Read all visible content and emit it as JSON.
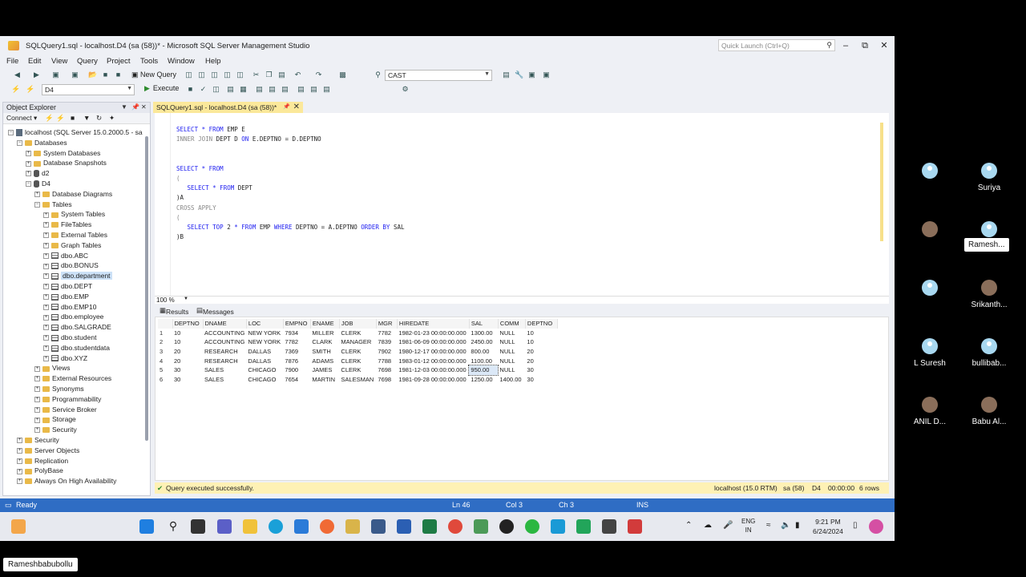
{
  "window": {
    "title": "SQLQuery1.sql - localhost.D4 (sa (58))* - Microsoft SQL Server Management Studio",
    "quick_launch_placeholder": "Quick Launch (Ctrl+Q)"
  },
  "menu": [
    "File",
    "Edit",
    "View",
    "Query",
    "Project",
    "Tools",
    "Window",
    "Help"
  ],
  "toolbar": {
    "new_query_label": "New Query",
    "find_combo_value": "CAST",
    "database_combo_value": "D4",
    "execute_label": "Execute"
  },
  "object_explorer": {
    "title": "Object Explorer",
    "connect_label": "Connect ▾",
    "nodes": [
      {
        "label": "localhost (SQL Server 15.0.2000.5 - sa",
        "type": "server",
        "exp": "−"
      },
      {
        "label": "Databases",
        "type": "folder",
        "exp": "−"
      },
      {
        "label": "System Databases",
        "type": "folder",
        "exp": "+"
      },
      {
        "label": "Database Snapshots",
        "type": "folder",
        "exp": "+"
      },
      {
        "label": "d2",
        "type": "db",
        "exp": "+"
      },
      {
        "label": "D4",
        "type": "db",
        "exp": "−"
      },
      {
        "label": "Database Diagrams",
        "type": "folder",
        "exp": "+"
      },
      {
        "label": "Tables",
        "type": "folder",
        "exp": "−"
      },
      {
        "label": "System Tables",
        "type": "folder",
        "exp": "+"
      },
      {
        "label": "FileTables",
        "type": "folder",
        "exp": "+"
      },
      {
        "label": "External Tables",
        "type": "folder",
        "exp": "+"
      },
      {
        "label": "Graph Tables",
        "type": "folder",
        "exp": "+"
      },
      {
        "label": "dbo.ABC",
        "type": "table",
        "exp": "+"
      },
      {
        "label": "dbo.BONUS",
        "type": "table",
        "exp": "+"
      },
      {
        "label": "dbo.department",
        "type": "table",
        "exp": "+",
        "selected": true
      },
      {
        "label": "dbo.DEPT",
        "type": "table",
        "exp": "+"
      },
      {
        "label": "dbo.EMP",
        "type": "table",
        "exp": "+"
      },
      {
        "label": "dbo.EMP10",
        "type": "table",
        "exp": "+"
      },
      {
        "label": "dbo.employee",
        "type": "table",
        "exp": "+"
      },
      {
        "label": "dbo.SALGRADE",
        "type": "table",
        "exp": "+"
      },
      {
        "label": "dbo.student",
        "type": "table",
        "exp": "+"
      },
      {
        "label": "dbo.studentdata",
        "type": "table",
        "exp": "+"
      },
      {
        "label": "dbo.XYZ",
        "type": "table",
        "exp": "+"
      },
      {
        "label": "Views",
        "type": "folder",
        "exp": "+"
      },
      {
        "label": "External Resources",
        "type": "folder",
        "exp": "+"
      },
      {
        "label": "Synonyms",
        "type": "folder",
        "exp": "+"
      },
      {
        "label": "Programmability",
        "type": "folder",
        "exp": "+"
      },
      {
        "label": "Service Broker",
        "type": "folder",
        "exp": "+"
      },
      {
        "label": "Storage",
        "type": "folder",
        "exp": "+"
      },
      {
        "label": "Security",
        "type": "folder",
        "exp": "+"
      },
      {
        "label": "Security",
        "type": "folder",
        "exp": "+"
      },
      {
        "label": "Server Objects",
        "type": "folder",
        "exp": "+"
      },
      {
        "label": "Replication",
        "type": "folder",
        "exp": "+"
      },
      {
        "label": "PolyBase",
        "type": "folder",
        "exp": "+"
      },
      {
        "label": "Always On High Availability",
        "type": "folder",
        "exp": "+"
      }
    ]
  },
  "editor": {
    "tab_label": "SQLQuery1.sql - localhost.D4 (sa (58))*",
    "zoom": "100 %",
    "lines": [
      [
        {
          "t": "SELECT * FROM ",
          "c": "kw"
        },
        {
          "t": "EMP E",
          "c": "tx"
        }
      ],
      [
        {
          "t": "INNER JOIN ",
          "c": "gr"
        },
        {
          "t": "DEPT D ",
          "c": "tx"
        },
        {
          "t": "ON ",
          "c": "kw"
        },
        {
          "t": "E.DEPTNO = D.DEPTNO",
          "c": "tx"
        }
      ],
      [],
      [
        {
          "t": "SELECT * FROM",
          "c": "kw"
        }
      ],
      [
        {
          "t": "(",
          "c": "gr"
        }
      ],
      [
        {
          "t": "   SELECT * FROM ",
          "c": "kw"
        },
        {
          "t": "DEPT",
          "c": "tx"
        }
      ],
      [
        {
          "t": ")A",
          "c": "tx"
        }
      ],
      [
        {
          "t": "CROSS APPLY",
          "c": "gr"
        }
      ],
      [
        {
          "t": "(",
          "c": "gr"
        }
      ],
      [
        {
          "t": "   SELECT TOP ",
          "c": "kw"
        },
        {
          "t": "2 ",
          "c": "tx"
        },
        {
          "t": "* FROM ",
          "c": "kw"
        },
        {
          "t": "EMP ",
          "c": "tx"
        },
        {
          "t": "WHERE ",
          "c": "kw"
        },
        {
          "t": "DEPTNO = A.DEPTNO ",
          "c": "tx"
        },
        {
          "t": "ORDER BY ",
          "c": "kw"
        },
        {
          "t": "SAL",
          "c": "tx"
        }
      ],
      [
        {
          "t": ")B",
          "c": "tx"
        }
      ]
    ]
  },
  "results": {
    "tab_results": "Results",
    "tab_messages": "Messages",
    "columns": [
      "DEPTNO",
      "DNAME",
      "LOC",
      "EMPNO",
      "ENAME",
      "JOB",
      "MGR",
      "HIREDATE",
      "SAL",
      "COMM",
      "DEPTNO"
    ],
    "rows": [
      [
        "1",
        "10",
        "ACCOUNTING",
        "NEW YORK",
        "7934",
        "MILLER",
        "CLERK",
        "7782",
        "1982-01-23 00:00:00.000",
        "1300.00",
        "NULL",
        "10"
      ],
      [
        "2",
        "10",
        "ACCOUNTING",
        "NEW YORK",
        "7782",
        "CLARK",
        "MANAGER",
        "7839",
        "1981-06-09 00:00:00.000",
        "2450.00",
        "NULL",
        "10"
      ],
      [
        "3",
        "20",
        "RESEARCH",
        "DALLAS",
        "7369",
        "SMITH",
        "CLERK",
        "7902",
        "1980-12-17 00:00:00.000",
        "800.00",
        "NULL",
        "20"
      ],
      [
        "4",
        "20",
        "RESEARCH",
        "DALLAS",
        "7876",
        "ADAMS",
        "CLERK",
        "7788",
        "1983-01-12 00:00:00.000",
        "1100.00",
        "NULL",
        "20"
      ],
      [
        "5",
        "30",
        "SALES",
        "CHICAGO",
        "7900",
        "JAMES",
        "CLERK",
        "7698",
        "1981-12-03 00:00:00.000",
        "950.00",
        "NULL",
        "30"
      ],
      [
        "6",
        "30",
        "SALES",
        "CHICAGO",
        "7654",
        "MARTIN",
        "SALESMAN",
        "7698",
        "1981-09-28 00:00:00.000",
        "1250.00",
        "1400.00",
        "30"
      ]
    ]
  },
  "query_status": {
    "message": "Query executed successfully.",
    "server": "localhost (15.0 RTM)",
    "user": "sa (58)",
    "db": "D4",
    "time": "00:00:00",
    "rows": "6 rows"
  },
  "statusbar": {
    "ready": "Ready",
    "ln": "Ln 46",
    "col": "Col 3",
    "ch": "Ch 3",
    "ins": "INS"
  },
  "taskbar": {
    "lang": "ENG",
    "region": "IN",
    "time": "9:21 PM",
    "date": "6/24/2024"
  },
  "participants": [
    {
      "name": "",
      "photo": false
    },
    {
      "name": "Suriya",
      "photo": false
    },
    {
      "name": "",
      "photo": true
    },
    {
      "name": "Ramesh...",
      "photo": false
    },
    {
      "name": "",
      "photo": false
    },
    {
      "name": "Srikanth...",
      "photo": true
    },
    {
      "name": "L Suresh",
      "photo": false
    },
    {
      "name": "bullibab...",
      "photo": false
    },
    {
      "name": "ANIL D...",
      "photo": true
    },
    {
      "name": "Babu Al...",
      "photo": true
    }
  ],
  "viewer_name": "Rameshbabubollu"
}
